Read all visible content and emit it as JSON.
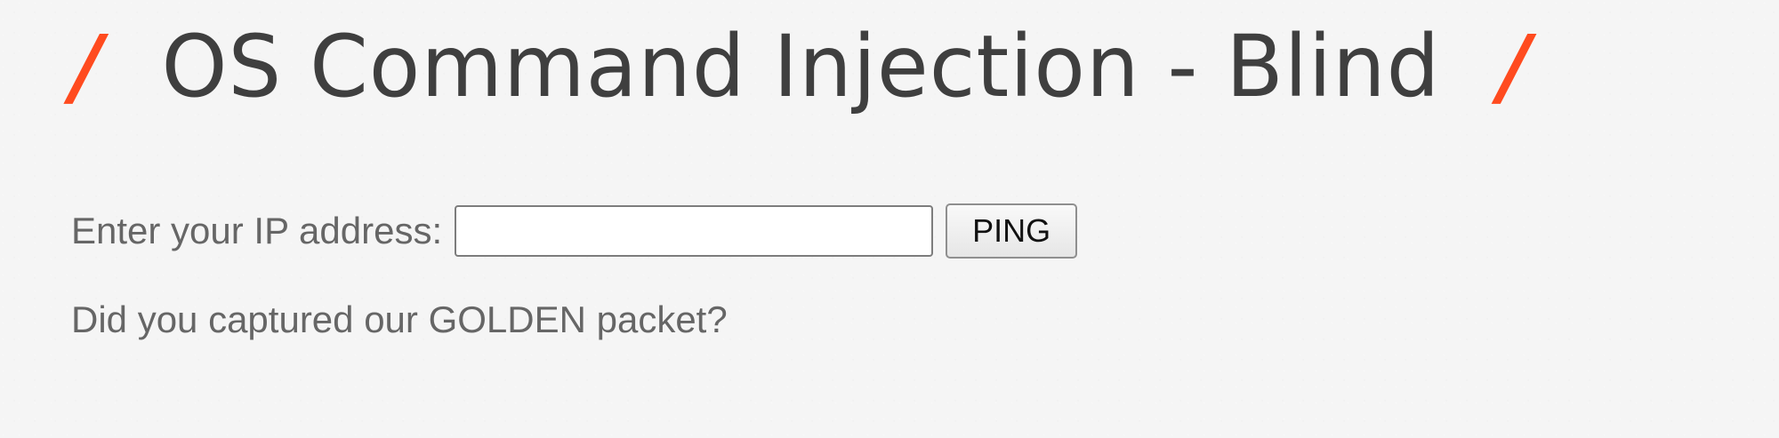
{
  "header": {
    "left_slash": "/",
    "title": "OS Command Injection - Blind",
    "right_slash": "/"
  },
  "form": {
    "label": "Enter your IP address:",
    "input_value": "",
    "button_label": "PING"
  },
  "message": "Did you captured our GOLDEN packet?",
  "colors": {
    "accent": "#ff4b1f",
    "text": "#555555",
    "title": "#3f3f3f",
    "background": "#f4f4f4"
  }
}
